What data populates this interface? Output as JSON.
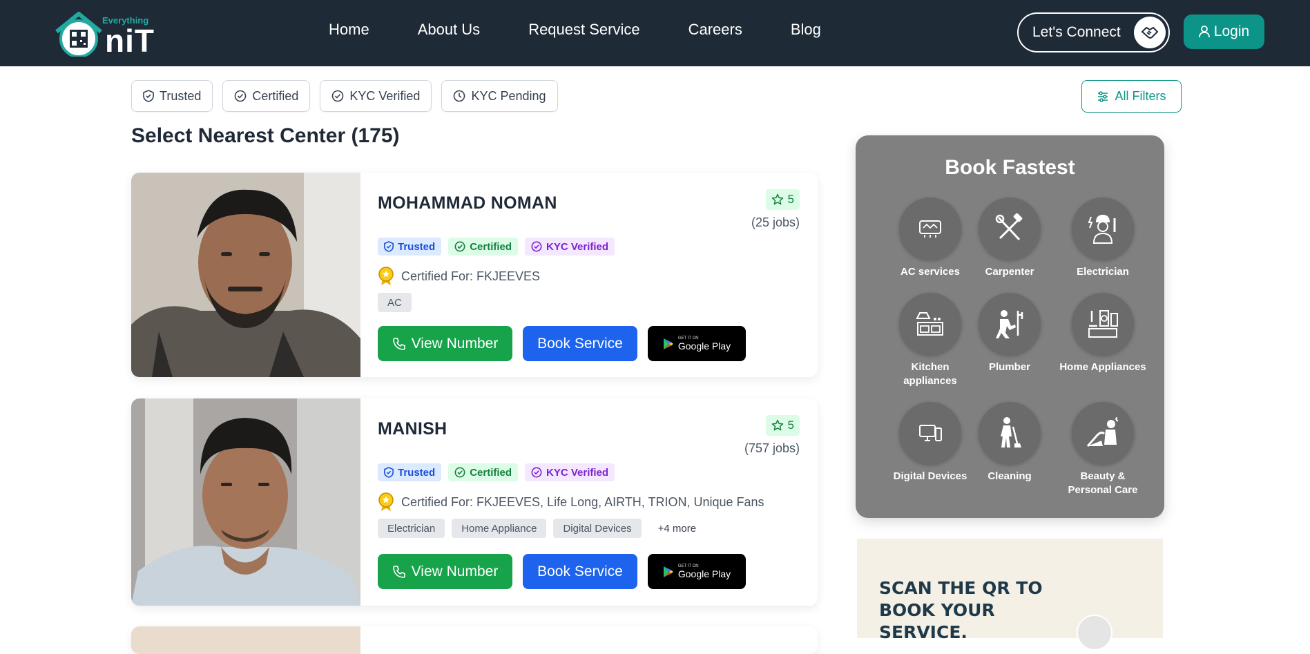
{
  "header": {
    "logo_small": "Everything",
    "logo_big": "OniT",
    "nav": [
      "Home",
      "About Us",
      "Request Service",
      "Careers",
      "Blog"
    ],
    "connect_label": "Let's Connect",
    "login_label": "Login"
  },
  "filters": {
    "chips": [
      "Trusted",
      "Certified",
      "KYC Verified",
      "KYC Pending"
    ],
    "all_filters_label": "All Filters"
  },
  "page_title": "Select Nearest Center (175)",
  "providers": [
    {
      "name": "MOHAMMAD NOMAN",
      "rating": "5",
      "jobs": "(25 jobs)",
      "badges": [
        "Trusted",
        "Certified",
        "KYC Verified"
      ],
      "certified_for": "Certified For: FKJEEVES",
      "tags": [
        "AC"
      ],
      "more": ""
    },
    {
      "name": "MANISH",
      "rating": "5",
      "jobs": "(757 jobs)",
      "badges": [
        "Trusted",
        "Certified",
        "KYC Verified"
      ],
      "certified_for": "Certified For: FKJEEVES, Life Long, AIRTH, TRION, Unique Fans",
      "tags": [
        "Electrician",
        "Home Appliance",
        "Digital Devices"
      ],
      "more": "+4 more"
    }
  ],
  "actions": {
    "view_number": "View Number",
    "book_service": "Book Service",
    "gplay_small": "GET IT ON",
    "gplay_big": "Google Play"
  },
  "book_fastest": {
    "title": "Book Fastest",
    "services": [
      {
        "label": "AC services",
        "icon": "ac-icon"
      },
      {
        "label": "Carpenter",
        "icon": "tools-icon"
      },
      {
        "label": "Electrician",
        "icon": "electrician-icon"
      },
      {
        "label": "Kitchen appliances",
        "icon": "kitchen-icon"
      },
      {
        "label": "Plumber",
        "icon": "plumber-icon"
      },
      {
        "label": "Home Appliances",
        "icon": "home-appliance-icon"
      },
      {
        "label": "Digital Devices",
        "icon": "devices-icon"
      },
      {
        "label": "Cleaning",
        "icon": "cleaning-icon"
      },
      {
        "label": "Beauty & Personal Care",
        "icon": "beauty-icon"
      }
    ]
  },
  "qr_banner": {
    "line1": "SCAN THE QR TO",
    "line2": "BOOK YOUR",
    "line3": "SERVICE."
  },
  "colors": {
    "header_bg": "#1f2a37",
    "accent": "#0d9488",
    "view_green": "#16a34a",
    "book_blue": "#1d63ed"
  }
}
